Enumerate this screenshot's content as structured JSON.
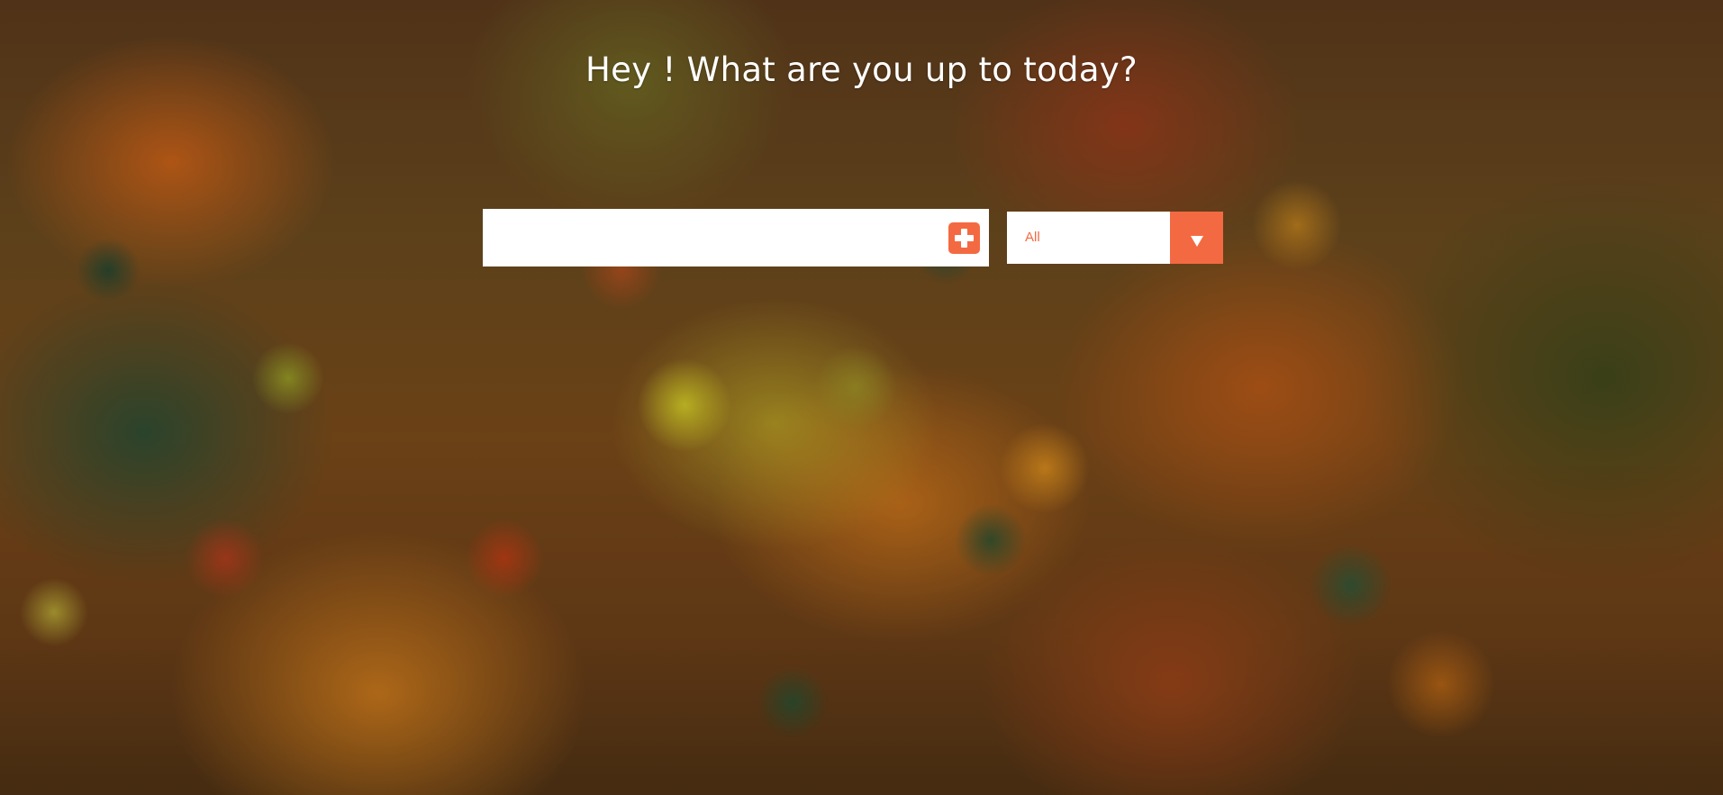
{
  "page": {
    "headline": "Hey ! What are you up to today?",
    "accent_color": "#f36a42"
  },
  "todo_form": {
    "input_value": "",
    "input_placeholder": "",
    "add_button_icon": "plus-icon"
  },
  "filter": {
    "selected": "All",
    "dropdown_icon": "caret-down-icon"
  }
}
